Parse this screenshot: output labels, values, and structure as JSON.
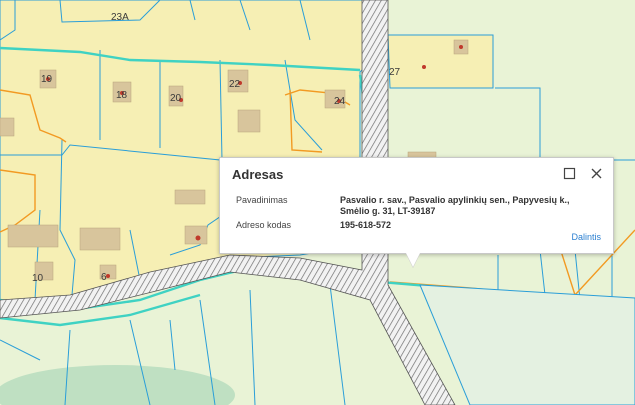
{
  "map": {
    "parcel_labels": [
      "23A",
      "19",
      "18",
      "20",
      "22",
      "24",
      "27",
      "10",
      "6"
    ]
  },
  "popup": {
    "title": "Adresas",
    "fields": [
      {
        "label": "Pavadinimas",
        "value": "Pasvalio r. sav., Pasvalio apylinkių sen., Papyvesių k., Smėlio g. 31, LT-39187"
      },
      {
        "label": "Adreso kodas",
        "value": "195-618-572"
      }
    ],
    "share_label": "Dalintis",
    "maximize_icon": "maximize-icon",
    "close_icon": "close-icon"
  },
  "colors": {
    "parcel_yellow": "#f6efb4",
    "background_green": "#e9f3d6",
    "cadastre_teal": "#3fd2c3",
    "boundary_blue": "#2a9ed8",
    "building_tan": "#d8c59c",
    "road_stripe": "#777777",
    "orange_line": "#f29a22"
  }
}
